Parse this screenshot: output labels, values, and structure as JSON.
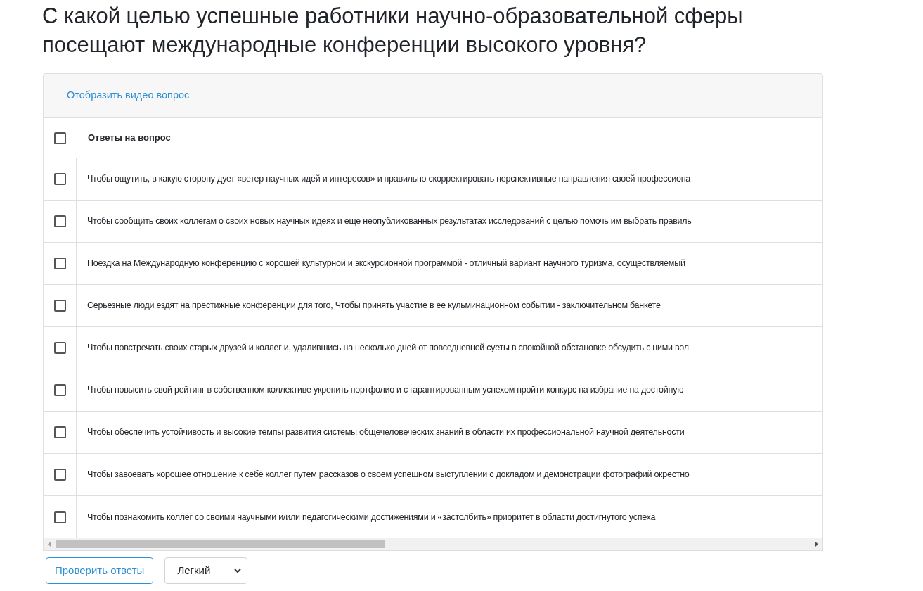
{
  "title": "С какой целью успешные работники научно-образовательной сферы посещают международные конференции высокого уровня?",
  "video_link": "Отобразить видео вопрос",
  "table": {
    "header": {
      "checked": false,
      "label": "Ответы на вопрос"
    },
    "rows": [
      {
        "checked": false,
        "text": "Чтобы ощутить, в какую сторону дует «ветер научных идей и интересов» и правильно скорректировать перспективные направления своей профессиона"
      },
      {
        "checked": false,
        "text": "Чтобы сообщить своих коллегам о своих новых научных идеях и еще неопубликованных результатах исследований с целью помочь им выбрать правиль"
      },
      {
        "checked": false,
        "text": "Поездка на Международную конференцию с хорошей культурной и экскурсионной программой - отличный вариант научного туризма, осуществляемый"
      },
      {
        "checked": false,
        "text": "Серьезные люди ездят на престижные конференции для того, Чтобы принять участие в ее кульминационном событии - заключительном банкете"
      },
      {
        "checked": false,
        "text": "Чтобы повстречать своих старых друзей и коллег и, удалившись на несколько дней от повседневной суеты в спокойной обстановке обсудить с ними вол"
      },
      {
        "checked": false,
        "text": "Чтобы повысить свой рейтинг в собственном коллективе укрепить портфолио и с гарантированным успехом пройти конкурс на избрание на достойную"
      },
      {
        "checked": false,
        "text": "Чтобы обеспечить устойчивость и высокие темпы развития системы общечеловеческих знаний в области их профессиональной научной деятельности"
      },
      {
        "checked": false,
        "text": "Чтобы завоевать хорошее отношение к себе коллег путем рассказов о своем успешном выступлении с докладом и демонстрации фотографий окрестно"
      },
      {
        "checked": false,
        "text": "Чтобы познакомить коллег со своими научными и/или педагогическими достижениями и «застолбить» приоритет в области достигнутого успеха"
      }
    ]
  },
  "check_button": "Проверить ответы",
  "difficulty": {
    "value": "Легкий"
  }
}
